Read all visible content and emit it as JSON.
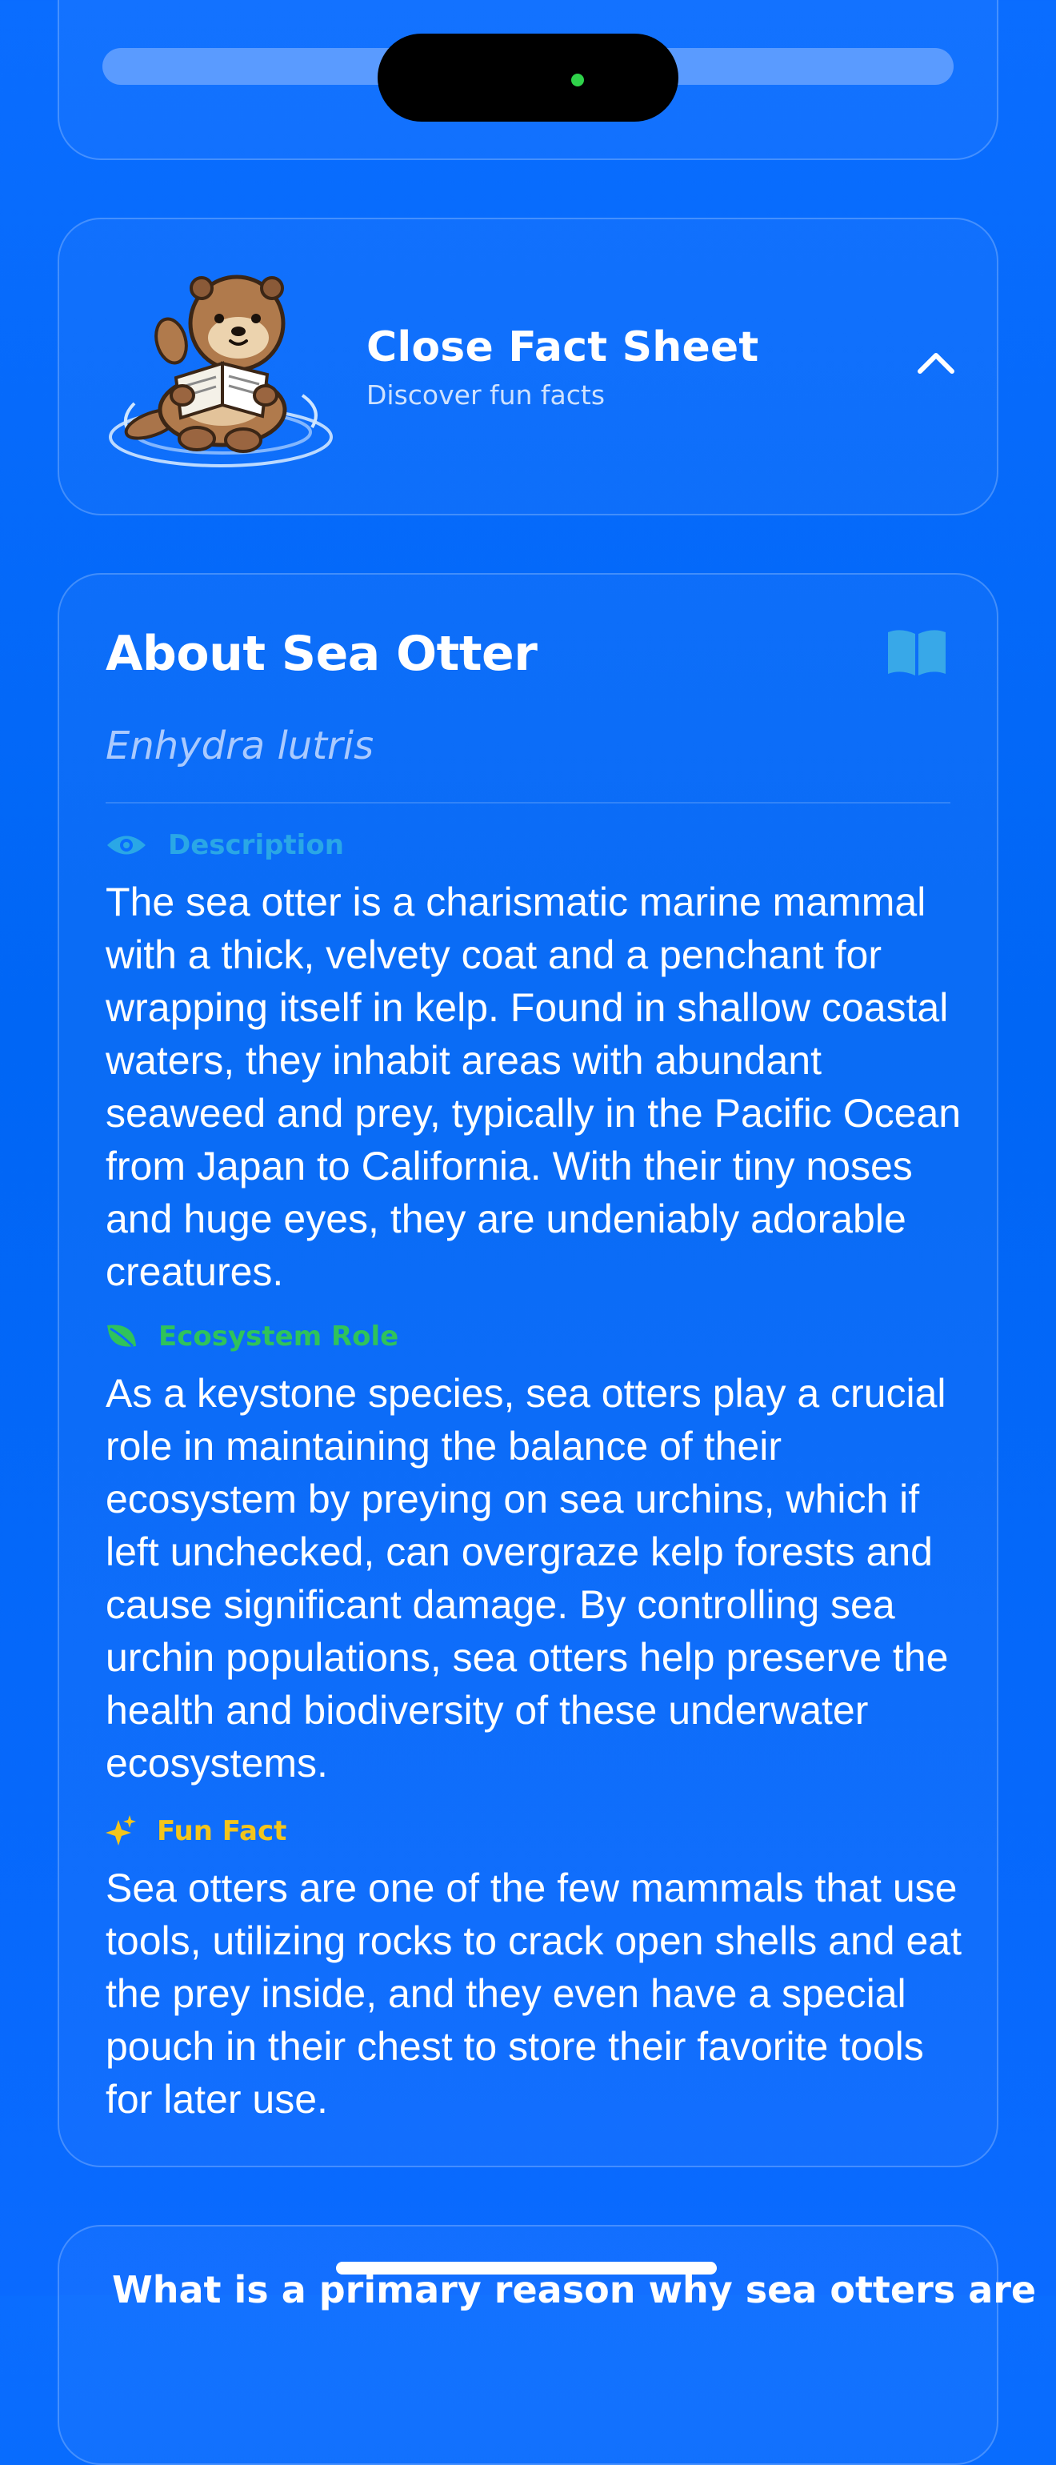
{
  "fact_sheet_toggle": {
    "title": "Close Fact Sheet",
    "subtitle": "Discover fun facts",
    "chevron_icon": "chevron-up-icon",
    "illustration_icon": "sea-otter-reading-illustration"
  },
  "about": {
    "title": "About Sea Otter",
    "scientific_name": "Enhydra lutris",
    "book_icon": "book-open-icon",
    "sections": [
      {
        "label": "Description",
        "icon": "eye-icon",
        "color": "#2aa7e6",
        "text": "The sea otter is a charismatic marine mammal with a thick, velvety coat and a penchant for wrapping itself in kelp. Found in shallow coastal waters, they inhabit areas with abundant seaweed and prey, typically in the Pacific Ocean from Japan to California. With their tiny noses and huge eyes, they are undeniably adorable creatures."
      },
      {
        "label": "Ecosystem Role",
        "icon": "leaf-icon",
        "color": "#2fc35b",
        "text": "As a keystone species, sea otters play a crucial role in maintaining the balance of their ecosystem by preying on sea urchins, which if left unchecked, can overgraze kelp forests and cause significant damage. By controlling sea urchin populations, sea otters help preserve the health and biodiversity of these underwater ecosystems."
      },
      {
        "label": "Fun Fact",
        "icon": "sparkles-icon",
        "color": "#f4c51b",
        "text": "Sea otters are one of the few mammals that use tools, utilizing rocks to crack open shells and eat the prey inside, and they even have a special pouch in their chest to store their favorite tools for later use."
      }
    ]
  },
  "question": {
    "text": "What is a primary reason why sea otters are"
  },
  "colors": {
    "background": "#0a6dff",
    "accent_description": "#2aa7e6",
    "accent_ecosystem": "#2fc35b",
    "accent_fun_fact": "#f4c51b"
  }
}
